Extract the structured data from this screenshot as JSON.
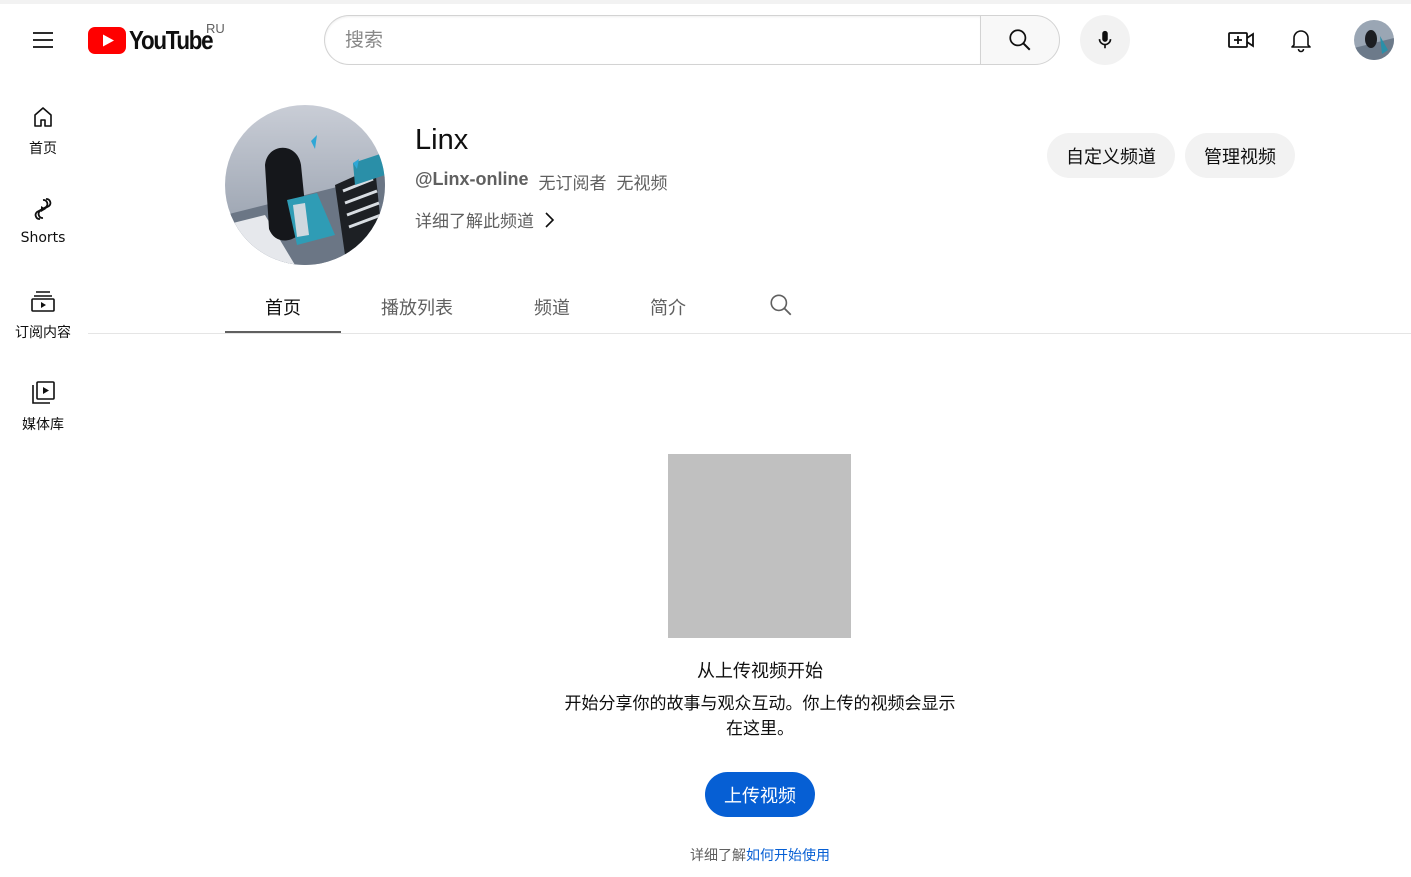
{
  "masthead": {
    "logo_text": "YouTube",
    "country_code": "RU",
    "search_placeholder": "搜索",
    "icons": [
      "menu-icon",
      "youtube-logo-icon",
      "search-icon",
      "mic-icon",
      "create-video-icon",
      "bell-icon",
      "account-avatar"
    ]
  },
  "guide": {
    "items": [
      {
        "label": "首页",
        "icon": "home-icon"
      },
      {
        "label": "Shorts",
        "icon": "shorts-icon"
      },
      {
        "label": "订阅内容",
        "icon": "subscriptions-icon"
      },
      {
        "label": "媒体库",
        "icon": "library-icon"
      }
    ]
  },
  "channel": {
    "name": "Linx",
    "handle": "@Linx-online",
    "subscribers": "无订阅者",
    "videos": "无视频",
    "more_about": "详细了解此频道",
    "customize_label": "自定义频道",
    "manage_label": "管理视频"
  },
  "tabs": [
    {
      "label": "首页",
      "active": true
    },
    {
      "label": "播放列表",
      "active": false
    },
    {
      "label": "频道",
      "active": false
    },
    {
      "label": "简介",
      "active": false
    }
  ],
  "empty_state": {
    "title": "从上传视频开始",
    "description": "开始分享你的故事与观众互动。你上传的视频会显示在这里。",
    "upload_label": "上传视频",
    "learn_prefix": "详细了解",
    "learn_link": "如何开始使用"
  },
  "colors": {
    "brand_red": "#ff0000",
    "primary_blue": "#065fd4",
    "pill_bg": "#f2f2f2",
    "text_secondary": "#606060",
    "placeholder_image": "#c0c0c0"
  }
}
